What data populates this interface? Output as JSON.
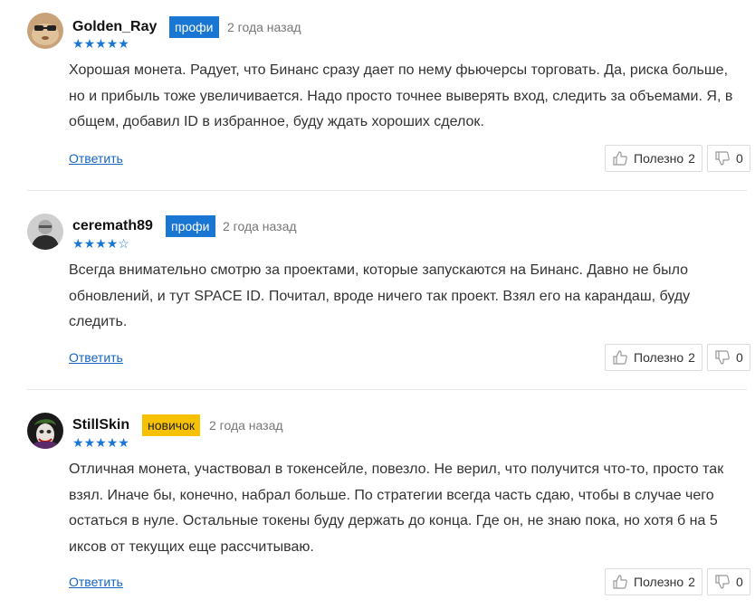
{
  "comments": [
    {
      "username": "Golden_Ray",
      "badge": "профи",
      "badge_type": "pro",
      "time": "2 года назад",
      "rating": 5,
      "text": "Хорошая монета. Радует, что Бинанс сразу дает по нему фьючерсы торговать. Да, риска больше, но и прибыль тоже увеличивается. Надо просто точнее выверять вход, следить за объемами. Я, в общем, добавил ID в избранное, буду ждать хороших сделок.",
      "reply_label": "Ответить",
      "useful_label": "Полезно",
      "useful_count": "2",
      "not_useful_count": "0"
    },
    {
      "username": "ceremath89",
      "badge": "профи",
      "badge_type": "pro",
      "time": "2 года назад",
      "rating": 4,
      "text": "Всегда внимательно смотрю за проектами, которые запускаются на Бинанс. Давно не было обновлений, и тут SPACE ID. Почитал, вроде ничего так проект. Взял его на карандаш, буду следить.",
      "reply_label": "Ответить",
      "useful_label": "Полезно",
      "useful_count": "2",
      "not_useful_count": "0"
    },
    {
      "username": "StillSkin",
      "badge": "новичок",
      "badge_type": "newbie",
      "time": "2 года назад",
      "rating": 5,
      "text": "Отличная монета, участвовал в токенсейле, повезло. Не верил, что получится что-то, просто так взял. Иначе бы, конечно, набрал больше. По стратегии всегда часть сдаю, чтобы в случае чего остаться в нуле. Остальные токены буду держать до конца. Где он, не знаю пока, но хотя б на 5 иксов от текущих еще рассчитываю.",
      "reply_label": "Ответить",
      "useful_label": "Полезно",
      "useful_count": "2",
      "not_useful_count": "0"
    }
  ],
  "colors": {
    "pro_badge": "#1976d2",
    "newbie_badge": "#f5c100",
    "star": "#1976d2",
    "link": "#1565c0"
  }
}
